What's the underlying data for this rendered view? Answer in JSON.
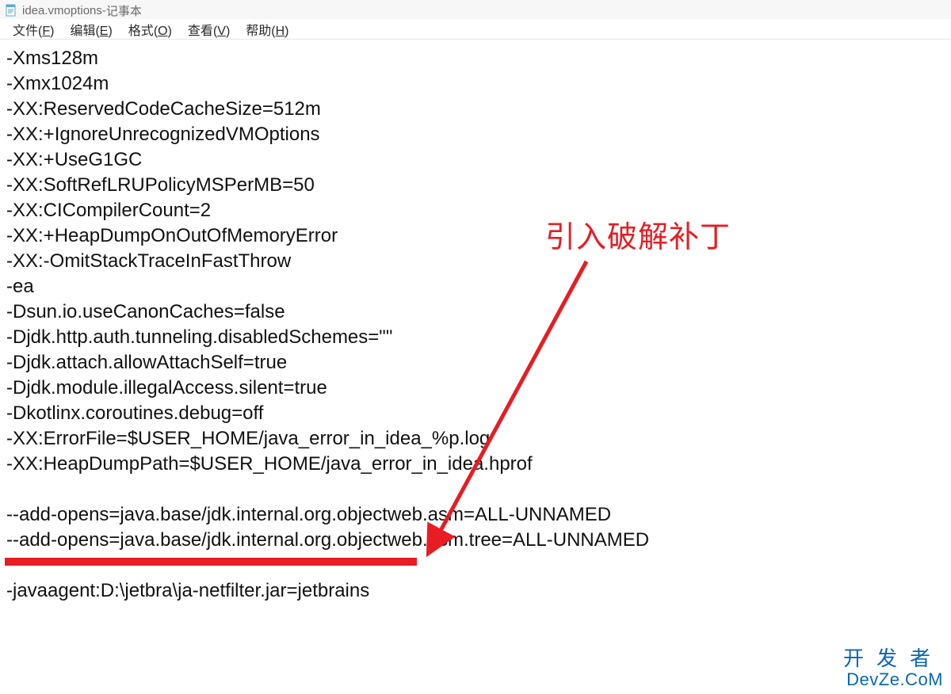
{
  "titlebar": {
    "filename": "idea.vmoptions",
    "separator": " - ",
    "appname": "记事本"
  },
  "menubar": {
    "file": {
      "label": "文件",
      "hotkey": "F"
    },
    "edit": {
      "label": "编辑",
      "hotkey": "E"
    },
    "format": {
      "label": "格式",
      "hotkey": "O"
    },
    "view": {
      "label": "查看",
      "hotkey": "V"
    },
    "help": {
      "label": "帮助",
      "hotkey": "H"
    }
  },
  "content": {
    "lines": [
      "-Xms128m",
      "-Xmx1024m",
      "-XX:ReservedCodeCacheSize=512m",
      "-XX:+IgnoreUnrecognizedVMOptions",
      "-XX:+UseG1GC",
      "-XX:SoftRefLRUPolicyMSPerMB=50",
      "-XX:CICompilerCount=2",
      "-XX:+HeapDumpOnOutOfMemoryError",
      "-XX:-OmitStackTraceInFastThrow",
      "-ea",
      "-Dsun.io.useCanonCaches=false",
      "-Djdk.http.auth.tunneling.disabledSchemes=\"\"",
      "-Djdk.attach.allowAttachSelf=true",
      "-Djdk.module.illegalAccess.silent=true",
      "-Dkotlinx.coroutines.debug=off",
      "-XX:ErrorFile=$USER_HOME/java_error_in_idea_%p.log",
      "-XX:HeapDumpPath=$USER_HOME/java_error_in_idea.hprof",
      "",
      "--add-opens=java.base/jdk.internal.org.objectweb.asm=ALL-UNNAMED",
      "--add-opens=java.base/jdk.internal.org.objectweb.asm.tree=ALL-UNNAMED",
      "",
      "-javaagent:D:\\jetbra\\ja-netfilter.jar=jetbrains"
    ]
  },
  "annotation": {
    "text": "引入破解补丁",
    "color": "#e81c23"
  },
  "watermark": {
    "cn": "开发者",
    "en": "DevZe.CoM"
  }
}
